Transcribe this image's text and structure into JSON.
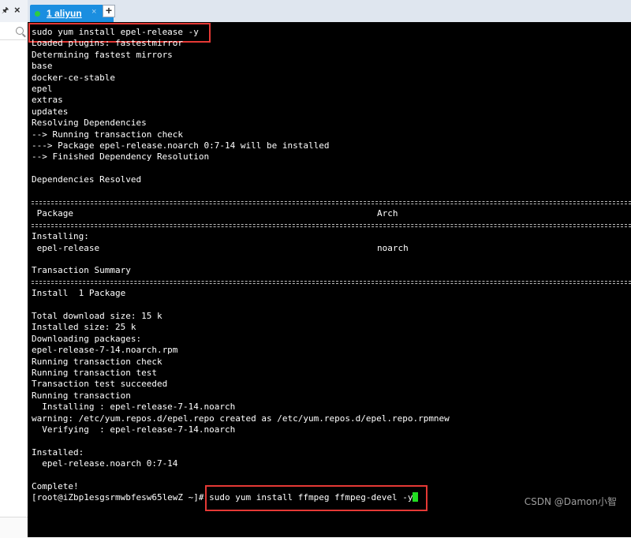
{
  "left_panel": {
    "pin_icon": "pin-icon",
    "close_icon": "close-icon",
    "search_icon": "search-icon"
  },
  "tab": {
    "index_label": "1",
    "name": "aliyun",
    "close": "×",
    "add": "+"
  },
  "terminal": {
    "lines": [
      "sudo yum install epel-release -y",
      "Loaded plugins: fastestmirror",
      "Determining fastest mirrors",
      "base",
      "docker-ce-stable",
      "epel",
      "extras",
      "updates",
      "Resolving Dependencies",
      "--> Running transaction check",
      "---> Package epel-release.noarch 0:7-14 will be installed",
      "--> Finished Dependency Resolution",
      "",
      "Dependencies Resolved",
      "",
      "",
      " Package",
      "",
      "Installing:",
      " epel-release",
      "",
      "Transaction Summary",
      "",
      "Install  1 Package",
      "",
      "Total download size: 15 k",
      "Installed size: 25 k",
      "Downloading packages:",
      "epel-release-7-14.noarch.rpm",
      "Running transaction check",
      "Running transaction test",
      "Transaction test succeeded",
      "Running transaction",
      "  Installing : epel-release-7-14.noarch",
      "warning: /etc/yum.repos.d/epel.repo created as /etc/yum.repos.d/epel.repo.rpmnew",
      "  Verifying  : epel-release-7-14.noarch",
      "",
      "Installed:",
      "  epel-release.noarch 0:7-14",
      "",
      "Complete!"
    ],
    "arch_header": "Arch",
    "arch_value": "noarch",
    "prompt": "[root@iZbp1esgsrmwbfesw65lewZ ~]# ",
    "command": "sudo yum install ffmpeg ffmpeg-devel -y",
    "cursor_color": "#22dd22",
    "highlight_color": "#e53935"
  },
  "watermark": "CSDN @Damon小智"
}
